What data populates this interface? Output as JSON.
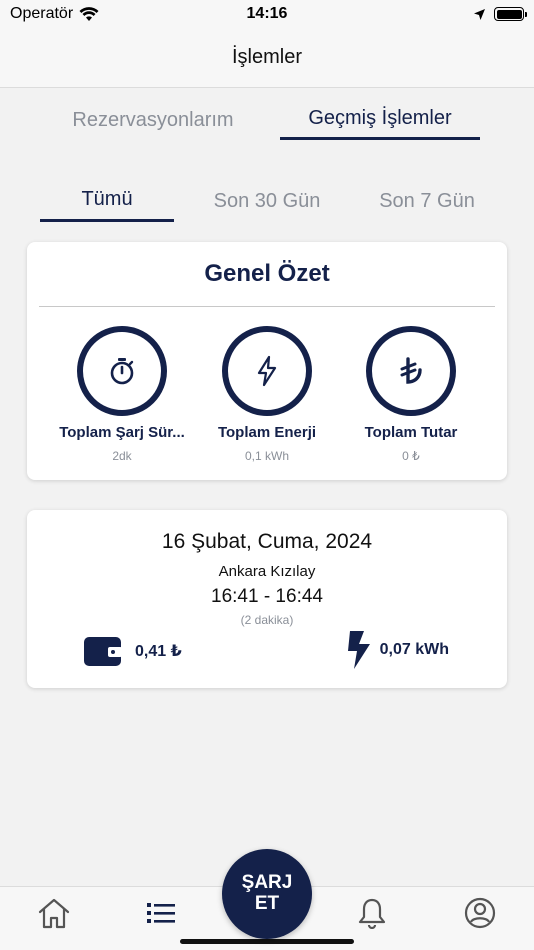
{
  "status_bar": {
    "carrier": "Operatör",
    "time": "14:16"
  },
  "nav": {
    "title": "İşlemler"
  },
  "top_tabs": [
    {
      "label": "Rezervasyonlarım",
      "active": false
    },
    {
      "label": "Geçmiş İşlemler",
      "active": true
    }
  ],
  "filter_tabs": [
    {
      "label": "Tümü",
      "active": true
    },
    {
      "label": "Son 30 Gün",
      "active": false
    },
    {
      "label": "Son 7 Gün",
      "active": false
    }
  ],
  "summary": {
    "title": "Genel Özet",
    "stats": [
      {
        "label": "Toplam Şarj Sür...",
        "value": "2dk",
        "icon": "stopwatch-icon"
      },
      {
        "label": "Toplam Enerji",
        "value": "0,1 kWh",
        "icon": "lightning-icon"
      },
      {
        "label": "Toplam Tutar",
        "value": "0 ₺",
        "icon": "lira-icon"
      }
    ]
  },
  "transactions": [
    {
      "date": "16 Şubat, Cuma, 2024",
      "location": "Ankara Kızılay",
      "time_range": "16:41 - 16:44",
      "duration": "(2 dakika)",
      "amount": "0,41 ₺",
      "energy": "0,07 kWh"
    }
  ],
  "tab_bar": {
    "charge_label_line1": "ŞARJ",
    "charge_label_line2": "ET",
    "items": [
      "home-icon",
      "list-icon",
      "bell-icon",
      "profile-icon"
    ]
  },
  "colors": {
    "primary": "#14214a",
    "muted": "#8a8f98",
    "background": "#f2f2f2"
  }
}
